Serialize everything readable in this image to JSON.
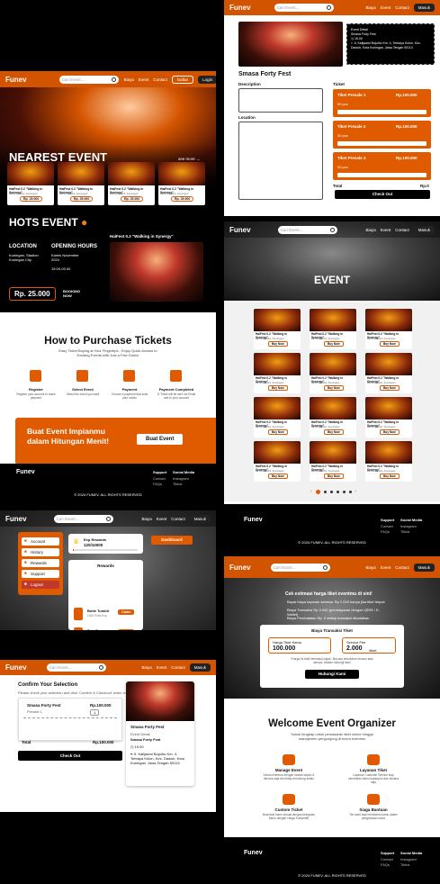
{
  "app": {
    "logo": "Funev",
    "search_placeholder": "Cari Event....",
    "nav": [
      "Biaya",
      "Event",
      "Contact"
    ],
    "daftar": "Daftar",
    "login": "Login",
    "masuk": "Masuk"
  },
  "home": {
    "nearest_title": "NEAREST EVENT",
    "see_more": "see more",
    "nearest_cards": [
      {
        "title": "HaiFest 0.2 \"Walking in Synergy\"",
        "meta": "28 Nov 2024, Kuningan",
        "price": "Rp. 25.000"
      },
      {
        "title": "HaiFest 0.2 \"Walking in Synergy\"",
        "meta": "28 Nov 2024, Kuningan",
        "price": "Rp. 25.000"
      },
      {
        "title": "HaiFest 0.2 \"Walking in Synergy\"",
        "meta": "28 Nov 2024, Kuningan",
        "price": "Rp. 25.000"
      },
      {
        "title": "HaiFest 0.2 \"Walking in Synergy\"",
        "meta": "28 Nov 2024, Kuningan",
        "price": "Rp. 25.000"
      }
    ],
    "hots_title": "HOTS EVENT",
    "location_label": "LOCATION",
    "location_value": "Kuningan, Stadion Kuningan City.",
    "hours_label": "OPENING HOURS",
    "hours_date": "Kamis November 2024",
    "hours_time": "15.00-00.00",
    "hots_event": "HaiFest 0.2 \"Walking in Synergy\"",
    "hots_price": "Rp. 25.000",
    "booking": "BOOKING NOW"
  },
  "howto": {
    "title": "How to Purchase Tickets",
    "subtitle": "Easy Ticket Buying at Your Fingertips - Enjoy Quick Access to Exciting Events with Just a Few Clicks!",
    "steps": [
      {
        "title": "Register",
        "desc": "Register your account to make payment",
        "icon": "register-icon"
      },
      {
        "title": "Select Event",
        "desc": "Select the event you want",
        "icon": "plus-icon"
      },
      {
        "title": "Payment",
        "desc": "Choose a payment that suits your needs",
        "icon": "payment-icon"
      },
      {
        "title": "Payment Completed",
        "desc": "E-Ticket will be sent via Email and to your account",
        "icon": "ticket-icon"
      }
    ],
    "cta_text": "Buat Event Impianmu dalam Hitungan Menit!",
    "cta_button": "Buat Event"
  },
  "footer": {
    "logo": "Funev",
    "col1": "Support",
    "col1_items": [
      "Contact",
      "FAQs"
    ],
    "col2": "Social Media",
    "col2_items": [
      "Instagram",
      "Tiktok"
    ],
    "copyright": "© 2024 FUNEV. ALL RIGHTS RESERVED"
  },
  "detail": {
    "info_lines": [
      "Event Detail",
      "Smasa Forty Fest",
      "15.00",
      "Jl. Kalijaami Bojo/bo Km. 4, Terbaya Kulon, Kec. Dawuh, Kota Kuningan, Jawa Tengah 59113"
    ],
    "event_name": "Smasa Forty Fest",
    "description_label": "Description",
    "location_label": "Location",
    "ticket_label": "Ticket",
    "tickets": [
      {
        "name": "Tiket Presale 1",
        "price": "Rp.100.000",
        "qty": "00 pcs"
      },
      {
        "name": "Tiket Presale 2",
        "price": "Rp.100.000",
        "qty": "00 pcs"
      },
      {
        "name": "Tiket Presale 3",
        "price": "Rp.100.000",
        "qty": "00 pcs"
      }
    ],
    "total_label": "Total",
    "total_value": "Rp.0",
    "checkout": "Check Out"
  },
  "events": {
    "title": "EVENT",
    "card": {
      "title": "HaiFest 0.2 \"Walking in Synergy\"",
      "meta": "28 Nov 2024, Kuningan",
      "button": "Buy Now"
    },
    "pagination": [
      "1",
      "2",
      "3",
      "4",
      "5",
      "6"
    ]
  },
  "dashboard": {
    "menu": [
      "Account",
      "History",
      "Rewards",
      "Support",
      "Logout"
    ],
    "exp_label": "Exp Rewards",
    "exp_value": "120/10000",
    "dashboard_btn": "Dashboard",
    "rewards_title": "Rewards",
    "rewards": [
      {
        "name": "Botle Tumblr",
        "pts": "1000 Point Exp",
        "btn": "Claim"
      },
      {
        "name": "Tote Bag",
        "pts": "1000 Point Exp",
        "btn": "Claim"
      },
      {
        "name": "Bounie hat",
        "pts": "",
        "btn": "Claim"
      }
    ]
  },
  "checkout": {
    "title": "Confirm Your Selection",
    "subtitle": "Please check your selection and click 'Confirm & Checkout' when ready",
    "item_name": "Smasa Forty Fest",
    "item_price": "Rp.100.000",
    "item_sub": "Presale 1",
    "qty_label": "1",
    "total_label": "Total",
    "total_value": "Rp.100.000",
    "checkout_btn": "Check Out",
    "event_name": "Smasa Forty Fest",
    "event_detail": "Event Detail",
    "event_detail_name": "Smasa Forty Fest",
    "time": "15.00",
    "address": "Jl. Kalijaami Bojo/bo Km. 4, Terbaya Kulon, Kec. Dawuh, Kota Kuningan, Jawa Tengah 59113"
  },
  "organizer": {
    "calc_title": "Cek estimasi harga tiket eventmu di sini!",
    "calc_points": [
      "Bayar biaya layanan sebesar Rp 2.000 hanya jika tiket terjual",
      "Biaya Transaksi Rp 4.440 (pembayaran dengan QRIS / E-Wallet)",
      "Biaya Pembatalan Rp. 0 setiap transaksi dibatalkan"
    ],
    "box_title": "Biaya Transaksi Tiket",
    "price_label": "Harga Tiket Kamu",
    "price_value": "100.000",
    "fee_label": "Service Fee",
    "fee_value": "2.000",
    "fee_unit": "/tiket",
    "note": "*Harga ini tidak termasuk pajak. Jika ada kebutuhan khusus atau lainnya, silakan hubungi kami",
    "contact_btn": "Hubungi Kami",
    "welcome_title": "Welcome Event Organizer",
    "welcome_sub": "Solusi lengkap untuk pemasaran tiket online hingga manajemen pengunjung di event eventmu",
    "features": [
      {
        "title": "Manage Event",
        "desc": "Kelola eventmu dengan mudah kapan & dimana saja dan tetap terhubung selalu",
        "icon": "manage-icon"
      },
      {
        "title": "Layanan Tiket",
        "desc": "Layanan Customer Service siap membantu kamu kapanpun dan dimana saja",
        "icon": "support-icon"
      },
      {
        "title": "Custom Ticket",
        "desc": "Buat tiket kamu sesuai dengan keinginan kamu dengan Harga Kompetitif",
        "icon": "ticket-icon"
      },
      {
        "title": "Siaga Bantuan",
        "desc": "Tim kami siap membantu kamu dalam pengelolaan event",
        "icon": "chat-icon"
      }
    ]
  }
}
